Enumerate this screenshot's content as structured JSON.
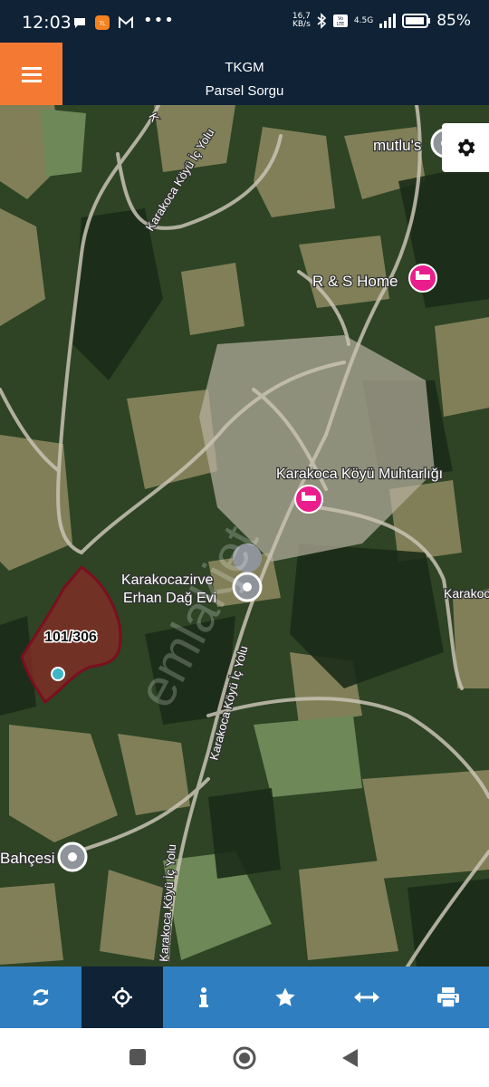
{
  "status_bar": {
    "time": "12:03",
    "speed_value": "16,7",
    "speed_unit": "KB/s",
    "network": "4.5G",
    "volte": "Vo LTE",
    "battery": "85%"
  },
  "app_bar": {
    "title": "TKGM",
    "subtitle": "Parsel Sorgu"
  },
  "map": {
    "places": {
      "mutlus": "mutlu's",
      "rs_home": "R & S Home",
      "muhtarlik": "Karakoca Köyü Muhtarlığı",
      "karakoca_right": "Karakoca",
      "zirve_line1": "Karakocazirve",
      "zirve_line2": "Erhan Dağ Evi",
      "bahcesi": "Bahçesi"
    },
    "roads": {
      "top": "Karakoca Köyü İç Yolu",
      "middle": "Karakoca Köyü İç Yolu",
      "bottom": "Karakoca Köyü İç Yolu",
      "top_fragment": "K"
    },
    "parcel_label": "101/306",
    "watermark": "emlakjet"
  },
  "toolbar": {
    "icons": [
      "refresh-icon",
      "crosshair-icon",
      "info-icon",
      "star-icon",
      "measure-icon",
      "print-icon"
    ]
  },
  "colors": {
    "header_bg": "#0f2236",
    "menu_accent": "#f47a33",
    "toolbar_bg": "#2f7fc0",
    "parcel_fill": "#8a2b26",
    "parcel_stroke": "#7a0f1f",
    "poi_pink": "#e91e8c"
  }
}
